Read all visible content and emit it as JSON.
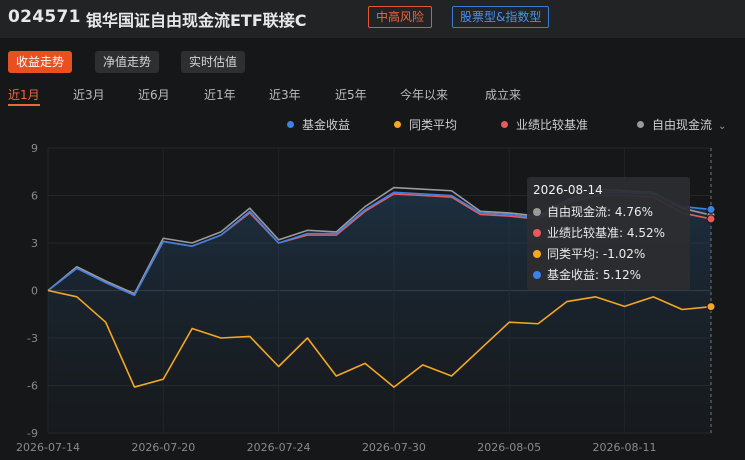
{
  "fund": {
    "code": "024571",
    "name": "银华国证自由现金流ETF联接C",
    "risk_tag": "中高风险",
    "type_tag": "股票型&指数型"
  },
  "modes": [
    {
      "label": "收益走势",
      "active": true
    },
    {
      "label": "净值走势",
      "active": false
    },
    {
      "label": "实时估值",
      "active": false
    }
  ],
  "periods": [
    {
      "label": "近1月",
      "active": true
    },
    {
      "label": "近3月",
      "active": false
    },
    {
      "label": "近6月",
      "active": false
    },
    {
      "label": "近1年",
      "active": false
    },
    {
      "label": "近3年",
      "active": false
    },
    {
      "label": "近5年",
      "active": false
    },
    {
      "label": "今年以来",
      "active": false
    },
    {
      "label": "成立来",
      "active": false
    }
  ],
  "legend": [
    {
      "label": "基金收益",
      "color": "#3b82e6"
    },
    {
      "label": "同类平均",
      "color": "#f5a623"
    },
    {
      "label": "业绩比较基准",
      "color": "#e85a5a"
    },
    {
      "label": "自由现金流",
      "color": "#9a9a9a",
      "dropdown": true
    }
  ],
  "tooltip": {
    "date": "2026-08-14",
    "rows": [
      {
        "label": "自由现金流:",
        "value": "4.76%",
        "color": "#9a9a9a"
      },
      {
        "label": "业绩比较基准:",
        "value": "4.52%",
        "color": "#e85a5a"
      },
      {
        "label": "同类平均:",
        "value": "-1.02%",
        "color": "#f5a623"
      },
      {
        "label": "基金收益:",
        "value": "5.12%",
        "color": "#3b82e6"
      }
    ]
  },
  "chart_data": {
    "type": "line",
    "x": [
      "2026-07-14",
      "2026-07-15",
      "2026-07-16",
      "2026-07-17",
      "2026-07-20",
      "2026-07-21",
      "2026-07-22",
      "2026-07-23",
      "2026-07-24",
      "2026-07-27",
      "2026-07-28",
      "2026-07-29",
      "2026-07-30",
      "2026-07-31",
      "2026-08-03",
      "2026-08-04",
      "2026-08-05",
      "2026-08-06",
      "2026-08-07",
      "2026-08-10",
      "2026-08-11",
      "2026-08-12",
      "2026-08-13",
      "2026-08-14"
    ],
    "x_tick_labels": [
      "2026-07-14",
      "2026-07-20",
      "2026-07-24",
      "2026-07-30",
      "2026-08-05",
      "2026-08-11"
    ],
    "y_ticks": [
      9,
      6,
      3,
      0,
      -3,
      -6,
      -9
    ],
    "ylim": [
      -9,
      9
    ],
    "series": [
      {
        "name": "自由现金流",
        "color": "#9a9a9a",
        "values": [
          0,
          1.5,
          0.6,
          -0.2,
          3.3,
          3.0,
          3.7,
          5.2,
          3.2,
          3.8,
          3.7,
          5.3,
          6.5,
          6.4,
          6.3,
          5.0,
          4.9,
          4.7,
          5.7,
          6.4,
          6.3,
          6.2,
          5.2,
          4.76
        ]
      },
      {
        "name": "业绩比较基准",
        "color": "#e85a5a",
        "values": [
          0,
          1.4,
          0.5,
          -0.3,
          3.1,
          2.8,
          3.5,
          4.9,
          3.0,
          3.5,
          3.5,
          5.0,
          6.1,
          6.0,
          5.9,
          4.8,
          4.7,
          4.5,
          5.5,
          6.0,
          6.0,
          5.9,
          4.9,
          4.52
        ]
      },
      {
        "name": "基金收益",
        "color": "#3b82e6",
        "values": [
          0,
          1.4,
          0.5,
          -0.3,
          3.1,
          2.8,
          3.5,
          5.0,
          3.0,
          3.6,
          3.6,
          5.1,
          6.2,
          6.1,
          6.0,
          4.9,
          4.8,
          4.6,
          5.6,
          6.2,
          6.2,
          6.1,
          5.3,
          5.12
        ]
      },
      {
        "name": "同类平均",
        "color": "#f5a623",
        "values": [
          0,
          -0.4,
          -2.0,
          -6.1,
          -5.6,
          -2.4,
          -3.0,
          -2.9,
          -4.8,
          -3.0,
          -5.4,
          -4.6,
          -6.1,
          -4.7,
          -5.4,
          -3.7,
          -2.0,
          -2.1,
          -0.7,
          -0.4,
          -1.0,
          -0.4,
          -1.2,
          -1.02
        ]
      }
    ]
  }
}
